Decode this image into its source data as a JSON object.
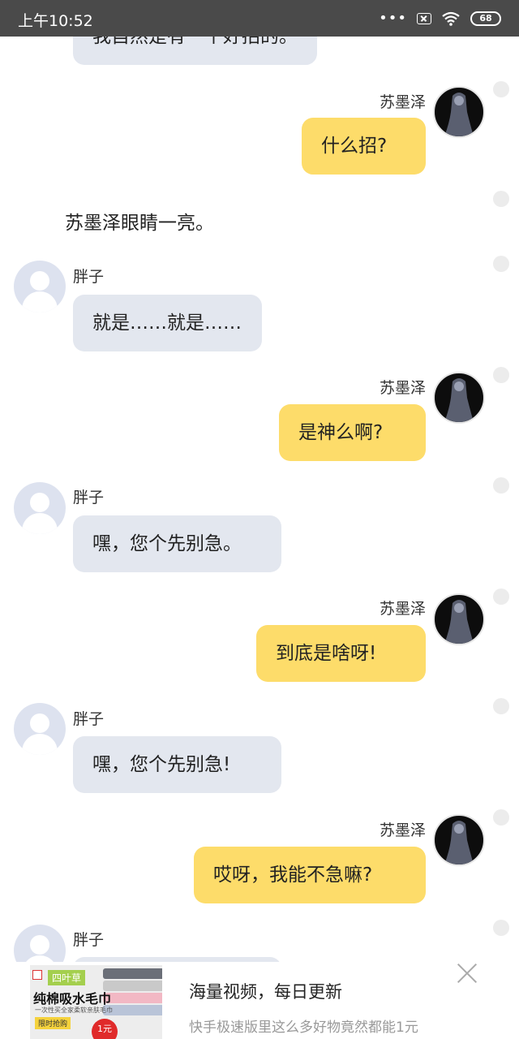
{
  "status_bar": {
    "time": "上午10:52",
    "dots": "•••",
    "battery": "68"
  },
  "chat": {
    "top_message": {
      "text": "我自然是有一个好招的。"
    },
    "messages": [
      {
        "speaker": "苏墨泽",
        "text": "什么招?"
      },
      {
        "speaker": "",
        "text": "苏墨泽眼睛一亮。"
      },
      {
        "speaker": "胖子",
        "text": "就是……就是……"
      },
      {
        "speaker": "苏墨泽",
        "text": "是神么啊?"
      },
      {
        "speaker": "胖子",
        "text": "嘿，您个先别急。"
      },
      {
        "speaker": "苏墨泽",
        "text": "到底是啥呀!"
      },
      {
        "speaker": "胖子",
        "text": "嘿，您个先别急!"
      },
      {
        "speaker": "苏墨泽",
        "text": "哎呀，我能不急嘛?"
      },
      {
        "speaker": "胖子",
        "text": ""
      }
    ]
  },
  "ad": {
    "image": {
      "brand": "四叶草",
      "product": "纯棉吸水毛巾",
      "subtitle": "一次性买全家柔软亲肤毛巾",
      "price": "1元",
      "cta": "限时抢购"
    },
    "title": "海量视频，每日更新",
    "description": "快手极速版里这么多好物竟然都能1元"
  },
  "colors": {
    "status_bar": "#4a4a4a",
    "bubble_left": "#e3e7ef",
    "bubble_right": "#fddc6a",
    "avatar_default": "#dde2ef"
  }
}
